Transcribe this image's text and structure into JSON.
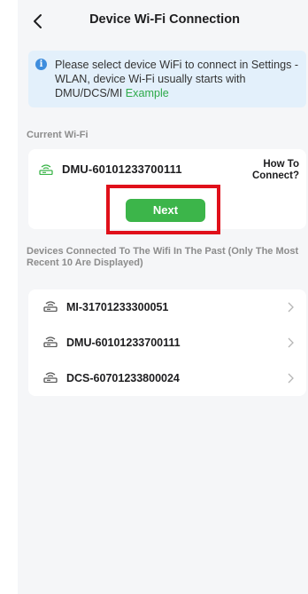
{
  "header": {
    "title": "Device Wi-Fi Connection"
  },
  "notice": {
    "text": "Please select device WiFi to connect in Settings - WLAN, device Wi-Fi usually starts with DMU/DCS/MI",
    "example_link": "Example"
  },
  "current": {
    "section_label": "Current Wi-Fi",
    "ssid": "DMU-60101233700111",
    "how_to_line1": "How To",
    "how_to_line2": "Connect?",
    "next_label": "Next"
  },
  "past": {
    "section_label": "Devices Connected To The Wifi In The Past (Only The Most Recent 10 Are Displayed)",
    "items": [
      {
        "ssid": "MI-31701233300051"
      },
      {
        "ssid": "DMU-60101233700111"
      },
      {
        "ssid": "DCS-60701233800024"
      }
    ]
  },
  "colors": {
    "accent_green": "#3cb54a",
    "highlight_red": "#e0101a",
    "info_blue": "#3e8ddd"
  }
}
